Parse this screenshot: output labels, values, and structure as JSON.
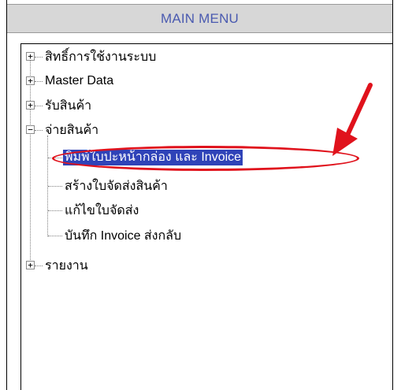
{
  "header": {
    "title": "MAIN MENU"
  },
  "tree": {
    "items": [
      {
        "label": "สิทธิ์การใช้งานระบบ",
        "expander": "+"
      },
      {
        "label": "Master Data",
        "expander": "+"
      },
      {
        "label": "รับสินค้า",
        "expander": "+"
      },
      {
        "label": "จ่ายสินค้า",
        "expander": "−"
      },
      {
        "label": "รายงาน",
        "expander": "+"
      }
    ],
    "children": [
      {
        "label": "พิมพ์ใบปะหน้ากล่อง และ Invoice"
      },
      {
        "label": "สร้างใบจัดส่งสินค้า"
      },
      {
        "label": "แก้ไขใบจัดส่ง"
      },
      {
        "label": "บันทึก Invoice ส่งกลับ"
      }
    ]
  },
  "colors": {
    "selection": "#2f43b8",
    "annotation": "#e0121c",
    "header_text": "#4a5ab0"
  }
}
